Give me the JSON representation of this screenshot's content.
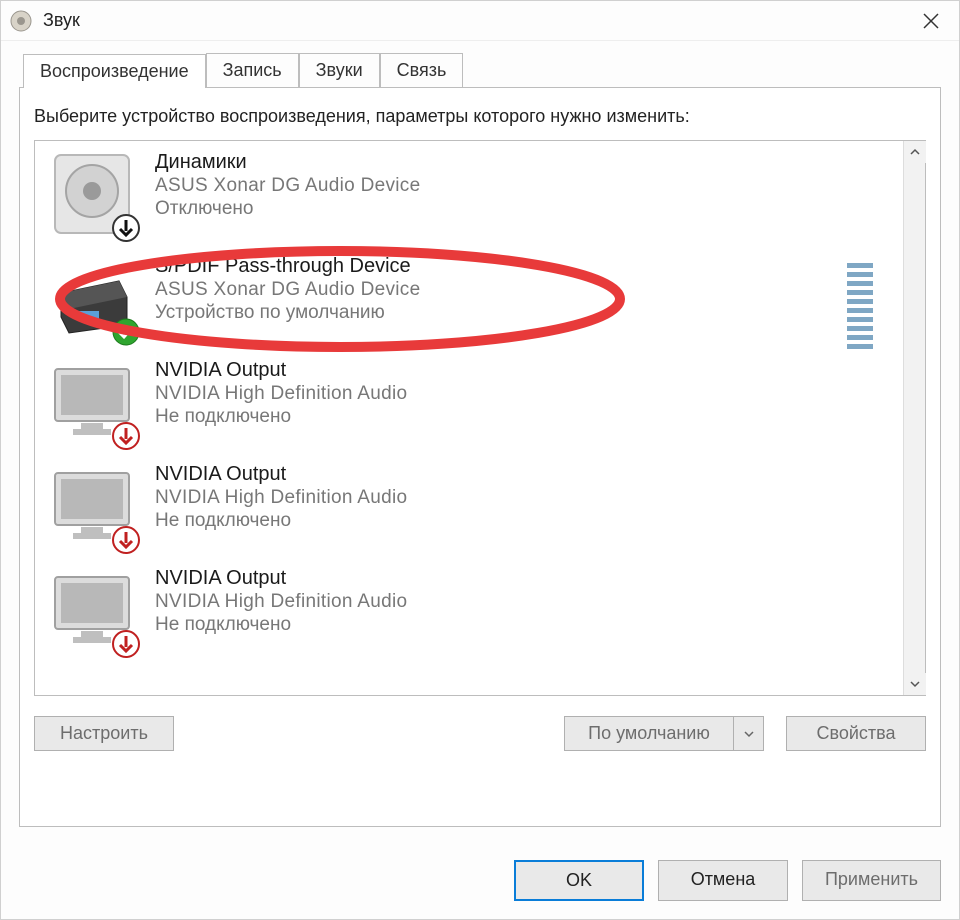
{
  "window": {
    "title": "Звук"
  },
  "tabs": [
    {
      "label": "Воспроизведение",
      "active": true
    },
    {
      "label": "Запись",
      "active": false
    },
    {
      "label": "Звуки",
      "active": false
    },
    {
      "label": "Связь",
      "active": false
    }
  ],
  "instruction": "Выберите устройство воспроизведения, параметры которого нужно изменить:",
  "devices": [
    {
      "title": "Динамики",
      "subtitle": "ASUS Xonar DG Audio Device",
      "status": "Отключено",
      "icon": "speaker",
      "badge": "disabled"
    },
    {
      "title": "S/PDIF Pass-through Device",
      "subtitle": "ASUS Xonar DG Audio Device",
      "status": "Устройство по умолчанию",
      "icon": "spdif",
      "badge": "default",
      "level_meter": true,
      "annotated": true
    },
    {
      "title": "NVIDIA Output",
      "subtitle": "NVIDIA High Definition Audio",
      "status": "Не подключено",
      "icon": "monitor",
      "badge": "unplugged"
    },
    {
      "title": "NVIDIA Output",
      "subtitle": "NVIDIA High Definition Audio",
      "status": "Не подключено",
      "icon": "monitor",
      "badge": "unplugged"
    },
    {
      "title": "NVIDIA Output",
      "subtitle": "NVIDIA High Definition Audio",
      "status": "Не подключено",
      "icon": "monitor",
      "badge": "unplugged"
    }
  ],
  "panel_buttons": {
    "configure": "Настроить",
    "set_default": "По умолчанию",
    "properties": "Свойства"
  },
  "dialog_buttons": {
    "ok": "OK",
    "cancel": "Отмена",
    "apply": "Применить"
  }
}
